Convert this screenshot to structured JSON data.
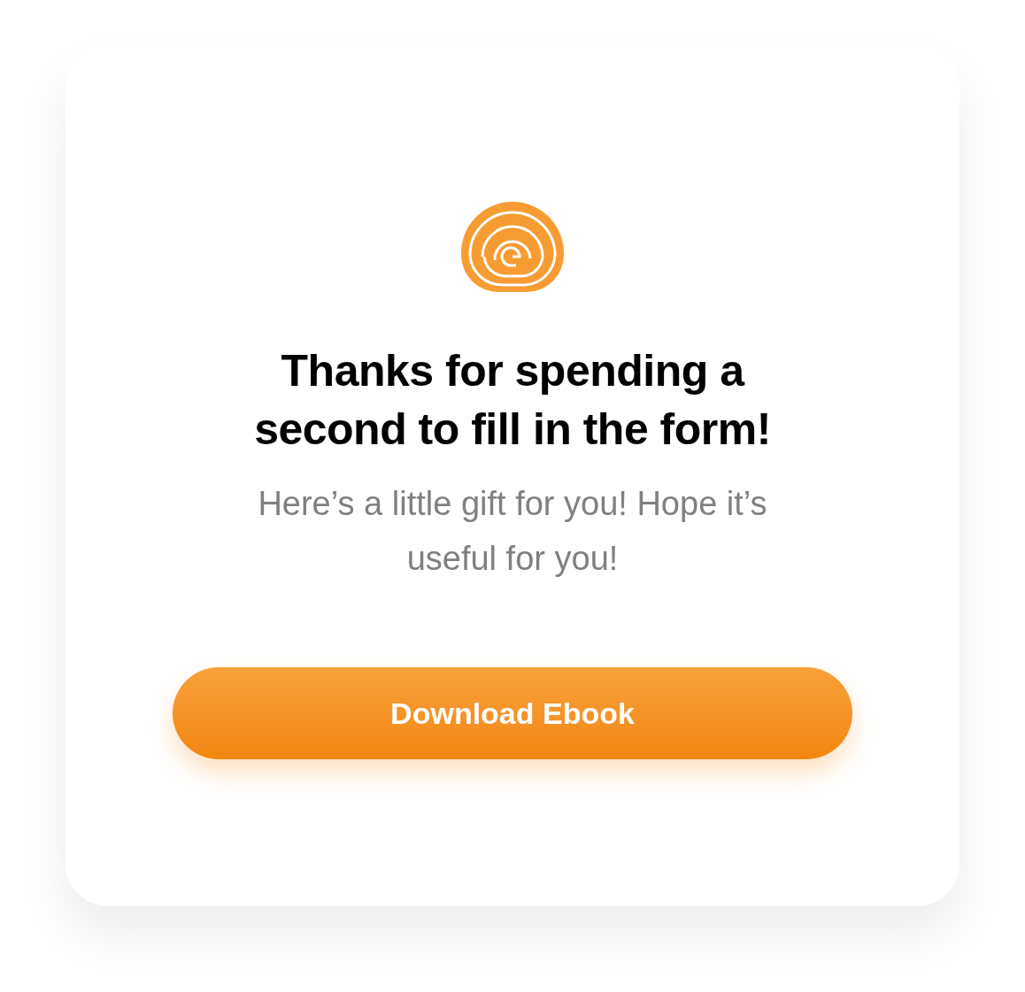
{
  "card": {
    "title": "Thanks for spending a second to fill in the form!",
    "message": "Here’s a little gift for you! Hope it’s useful for you!",
    "button": "Download Ebook"
  }
}
